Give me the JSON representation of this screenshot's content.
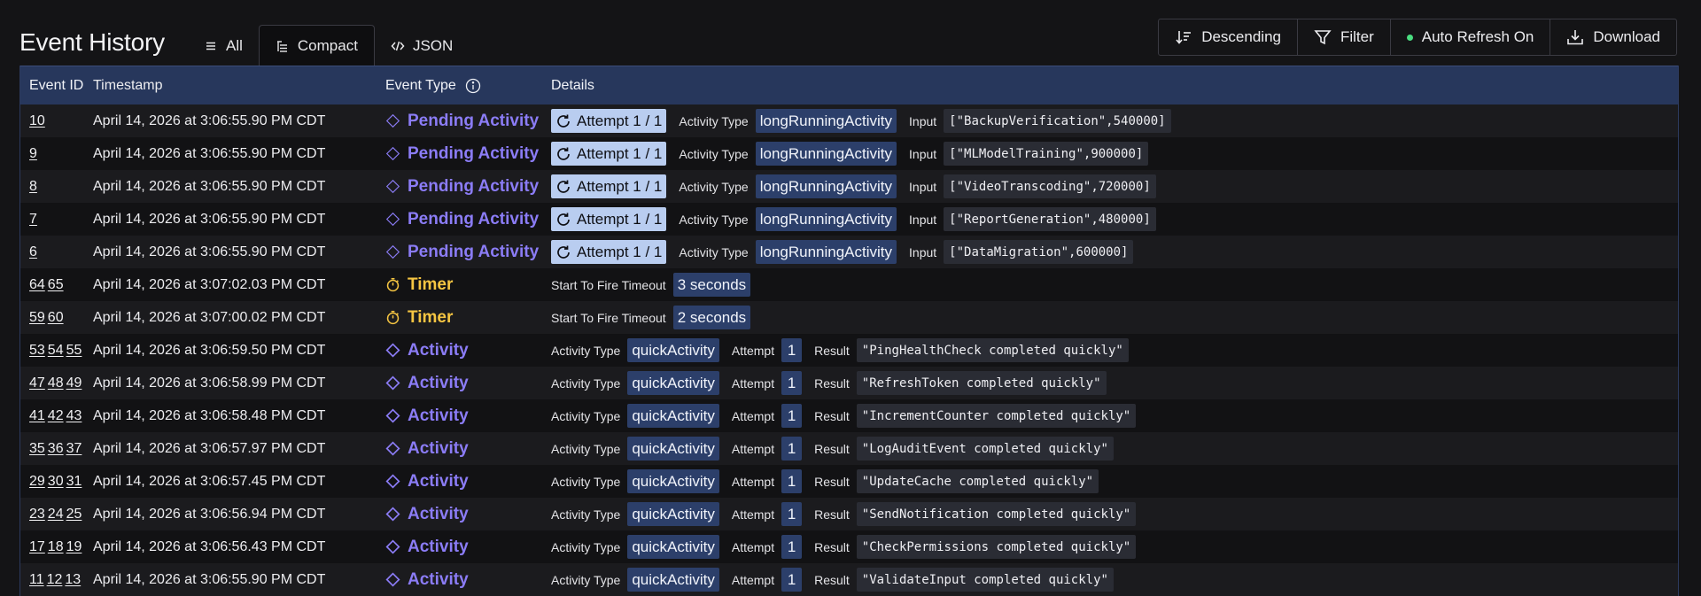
{
  "header": {
    "title": "Event History",
    "view_tabs": [
      {
        "label": "All",
        "icon": "list-icon",
        "active": false
      },
      {
        "label": "Compact",
        "icon": "compact-list-icon",
        "active": true
      },
      {
        "label": "JSON",
        "icon": "code-icon",
        "active": false
      }
    ],
    "actions": {
      "sort_label": "Descending",
      "filter_label": "Filter",
      "auto_refresh_label": "Auto Refresh On",
      "download_label": "Download"
    }
  },
  "table": {
    "columns": {
      "event_id": "Event ID",
      "timestamp": "Timestamp",
      "event_type": "Event Type",
      "details": "Details"
    },
    "labels": {
      "attempt_badge": "Attempt 1 / 1",
      "activity_type": "Activity Type",
      "input": "Input",
      "attempt": "Attempt",
      "result": "Result",
      "start_to_fire": "Start To Fire Timeout"
    },
    "rows": [
      {
        "ids": [
          "10"
        ],
        "timestamp": "April 14, 2026 at 3:06:55.90 PM CDT",
        "type": "Pending Activity",
        "kind": "pending",
        "activity_type": "longRunningActivity",
        "input": "[\"BackupVerification\",540000]"
      },
      {
        "ids": [
          "9"
        ],
        "timestamp": "April 14, 2026 at 3:06:55.90 PM CDT",
        "type": "Pending Activity",
        "kind": "pending",
        "activity_type": "longRunningActivity",
        "input": "[\"MLModelTraining\",900000]"
      },
      {
        "ids": [
          "8"
        ],
        "timestamp": "April 14, 2026 at 3:06:55.90 PM CDT",
        "type": "Pending Activity",
        "kind": "pending",
        "activity_type": "longRunningActivity",
        "input": "[\"VideoTranscoding\",720000]"
      },
      {
        "ids": [
          "7"
        ],
        "timestamp": "April 14, 2026 at 3:06:55.90 PM CDT",
        "type": "Pending Activity",
        "kind": "pending",
        "activity_type": "longRunningActivity",
        "input": "[\"ReportGeneration\",480000]"
      },
      {
        "ids": [
          "6"
        ],
        "timestamp": "April 14, 2026 at 3:06:55.90 PM CDT",
        "type": "Pending Activity",
        "kind": "pending",
        "activity_type": "longRunningActivity",
        "input": "[\"DataMigration\",600000]"
      },
      {
        "ids": [
          "64",
          "65"
        ],
        "timestamp": "April 14, 2026 at 3:07:02.03 PM CDT",
        "type": "Timer",
        "kind": "timer",
        "timeout": "3 seconds"
      },
      {
        "ids": [
          "59",
          "60"
        ],
        "timestamp": "April 14, 2026 at 3:07:00.02 PM CDT",
        "type": "Timer",
        "kind": "timer",
        "timeout": "2 seconds"
      },
      {
        "ids": [
          "53",
          "54",
          "55"
        ],
        "timestamp": "April 14, 2026 at 3:06:59.50 PM CDT",
        "type": "Activity",
        "kind": "activity",
        "activity_type": "quickActivity",
        "attempt": "1",
        "result": "\"PingHealthCheck completed quickly\""
      },
      {
        "ids": [
          "47",
          "48",
          "49"
        ],
        "timestamp": "April 14, 2026 at 3:06:58.99 PM CDT",
        "type": "Activity",
        "kind": "activity",
        "activity_type": "quickActivity",
        "attempt": "1",
        "result": "\"RefreshToken completed quickly\""
      },
      {
        "ids": [
          "41",
          "42",
          "43"
        ],
        "timestamp": "April 14, 2026 at 3:06:58.48 PM CDT",
        "type": "Activity",
        "kind": "activity",
        "activity_type": "quickActivity",
        "attempt": "1",
        "result": "\"IncrementCounter completed quickly\""
      },
      {
        "ids": [
          "35",
          "36",
          "37"
        ],
        "timestamp": "April 14, 2026 at 3:06:57.97 PM CDT",
        "type": "Activity",
        "kind": "activity",
        "activity_type": "quickActivity",
        "attempt": "1",
        "result": "\"LogAuditEvent completed quickly\""
      },
      {
        "ids": [
          "29",
          "30",
          "31"
        ],
        "timestamp": "April 14, 2026 at 3:06:57.45 PM CDT",
        "type": "Activity",
        "kind": "activity",
        "activity_type": "quickActivity",
        "attempt": "1",
        "result": "\"UpdateCache completed quickly\""
      },
      {
        "ids": [
          "23",
          "24",
          "25"
        ],
        "timestamp": "April 14, 2026 at 3:06:56.94 PM CDT",
        "type": "Activity",
        "kind": "activity",
        "activity_type": "quickActivity",
        "attempt": "1",
        "result": "\"SendNotification completed quickly\""
      },
      {
        "ids": [
          "17",
          "18",
          "19"
        ],
        "timestamp": "April 14, 2026 at 3:06:56.43 PM CDT",
        "type": "Activity",
        "kind": "activity",
        "activity_type": "quickActivity",
        "attempt": "1",
        "result": "\"CheckPermissions completed quickly\""
      },
      {
        "ids": [
          "11",
          "12",
          "13"
        ],
        "timestamp": "April 14, 2026 at 3:06:55.90 PM CDT",
        "type": "Activity",
        "kind": "activity",
        "activity_type": "quickActivity",
        "attempt": "1",
        "result": "\"ValidateInput completed quickly\""
      }
    ]
  },
  "colors": {
    "background": "#141416",
    "header_row": "#27375c",
    "activity": "#8b7cf6",
    "timer": "#f5c542",
    "chip": "#2c3f6a",
    "attempt_badge": "#b9cdf0",
    "auto_refresh_dot": "#4ade80"
  }
}
